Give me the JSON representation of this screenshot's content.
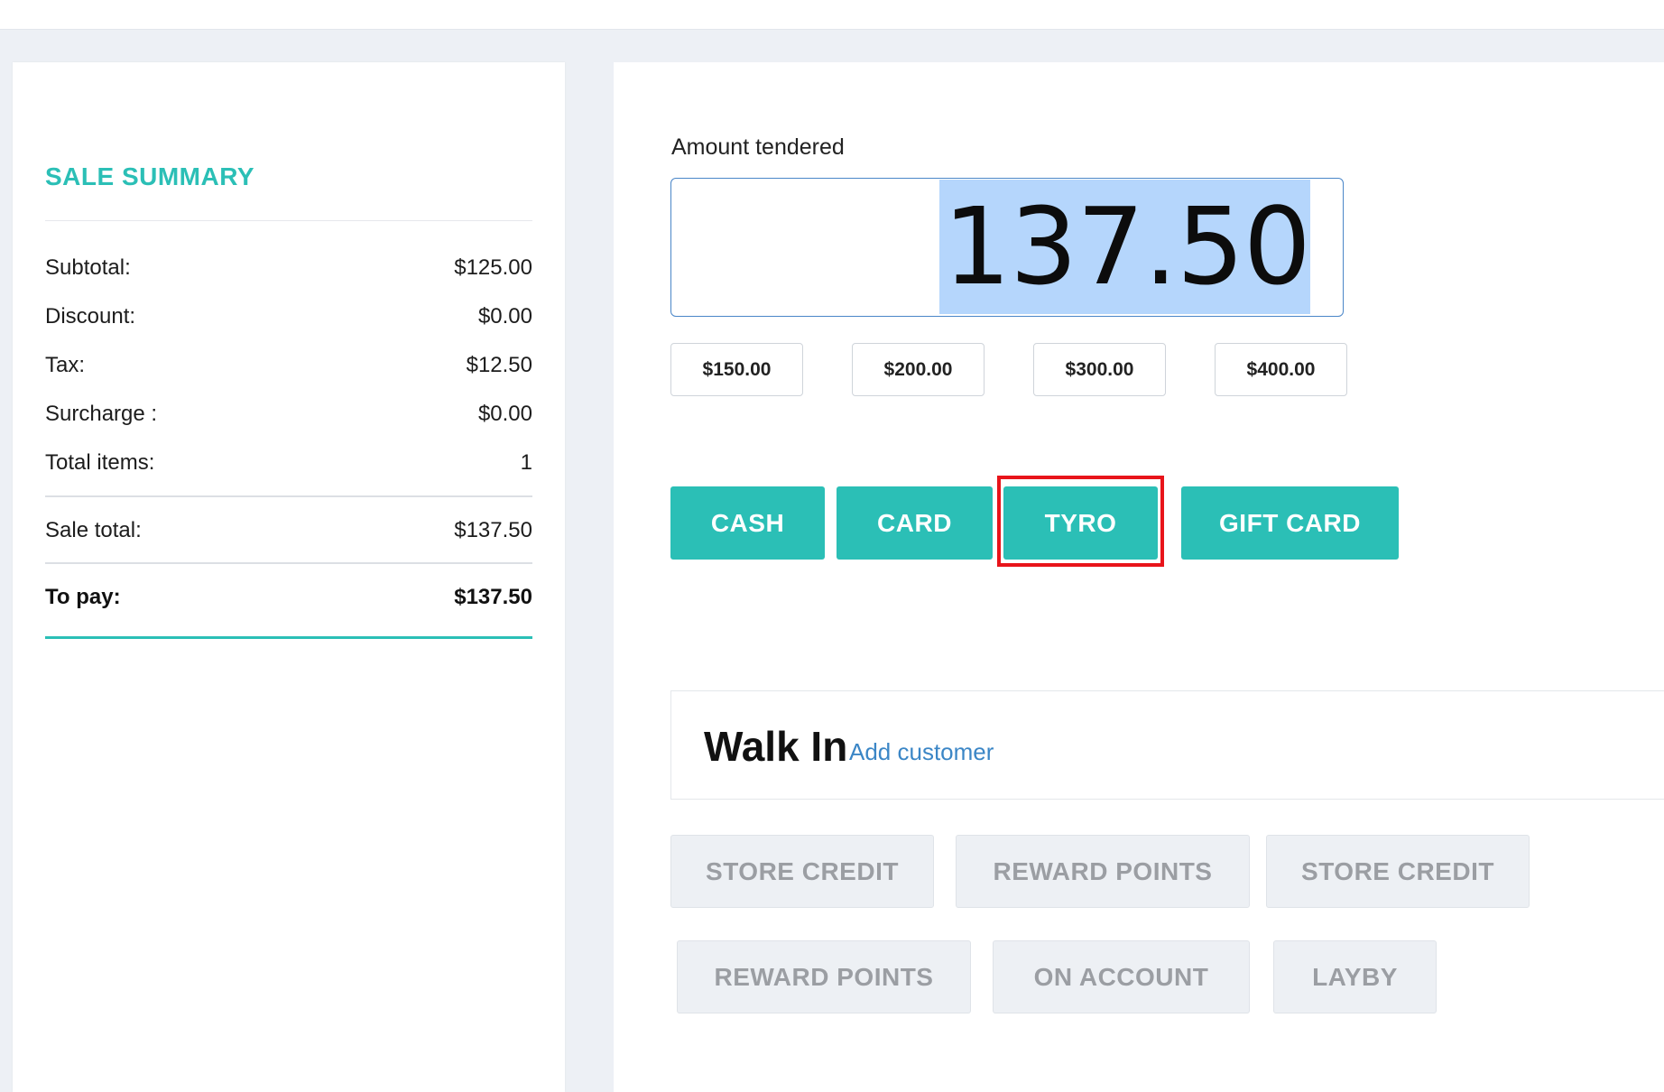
{
  "summary": {
    "title": "SALE SUMMARY",
    "rows": [
      {
        "label": "Subtotal:",
        "value": "$125.00"
      },
      {
        "label": "Discount:",
        "value": "$0.00"
      },
      {
        "label": "Tax:",
        "value": "$12.50"
      },
      {
        "label": "Surcharge :",
        "value": "$0.00"
      },
      {
        "label": "Total items:",
        "value": "1"
      }
    ],
    "sale_total": {
      "label": "Sale total:",
      "value": "$137.50"
    },
    "to_pay": {
      "label": "To pay:",
      "value": "$137.50"
    }
  },
  "payment": {
    "amount_label": "Amount tendered",
    "amount_value": "137.50",
    "quick_amounts": [
      "$150.00",
      "$200.00",
      "$300.00",
      "$400.00"
    ],
    "methods": [
      "CASH",
      "CARD",
      "TYRO",
      "GIFT CARD"
    ],
    "highlighted_method": "TYRO"
  },
  "customer": {
    "name": "Walk In",
    "add_link": "Add customer"
  },
  "alt_payments": {
    "row1": [
      "STORE CREDIT",
      "REWARD POINTS",
      "STORE CREDIT"
    ],
    "row2": [
      "REWARD POINTS",
      "ON ACCOUNT",
      "LAYBY"
    ]
  },
  "colors": {
    "accent": "#2bbfb6",
    "highlight": "#e8141a",
    "link": "#3b86c6",
    "selection": "#b5d6fc"
  }
}
